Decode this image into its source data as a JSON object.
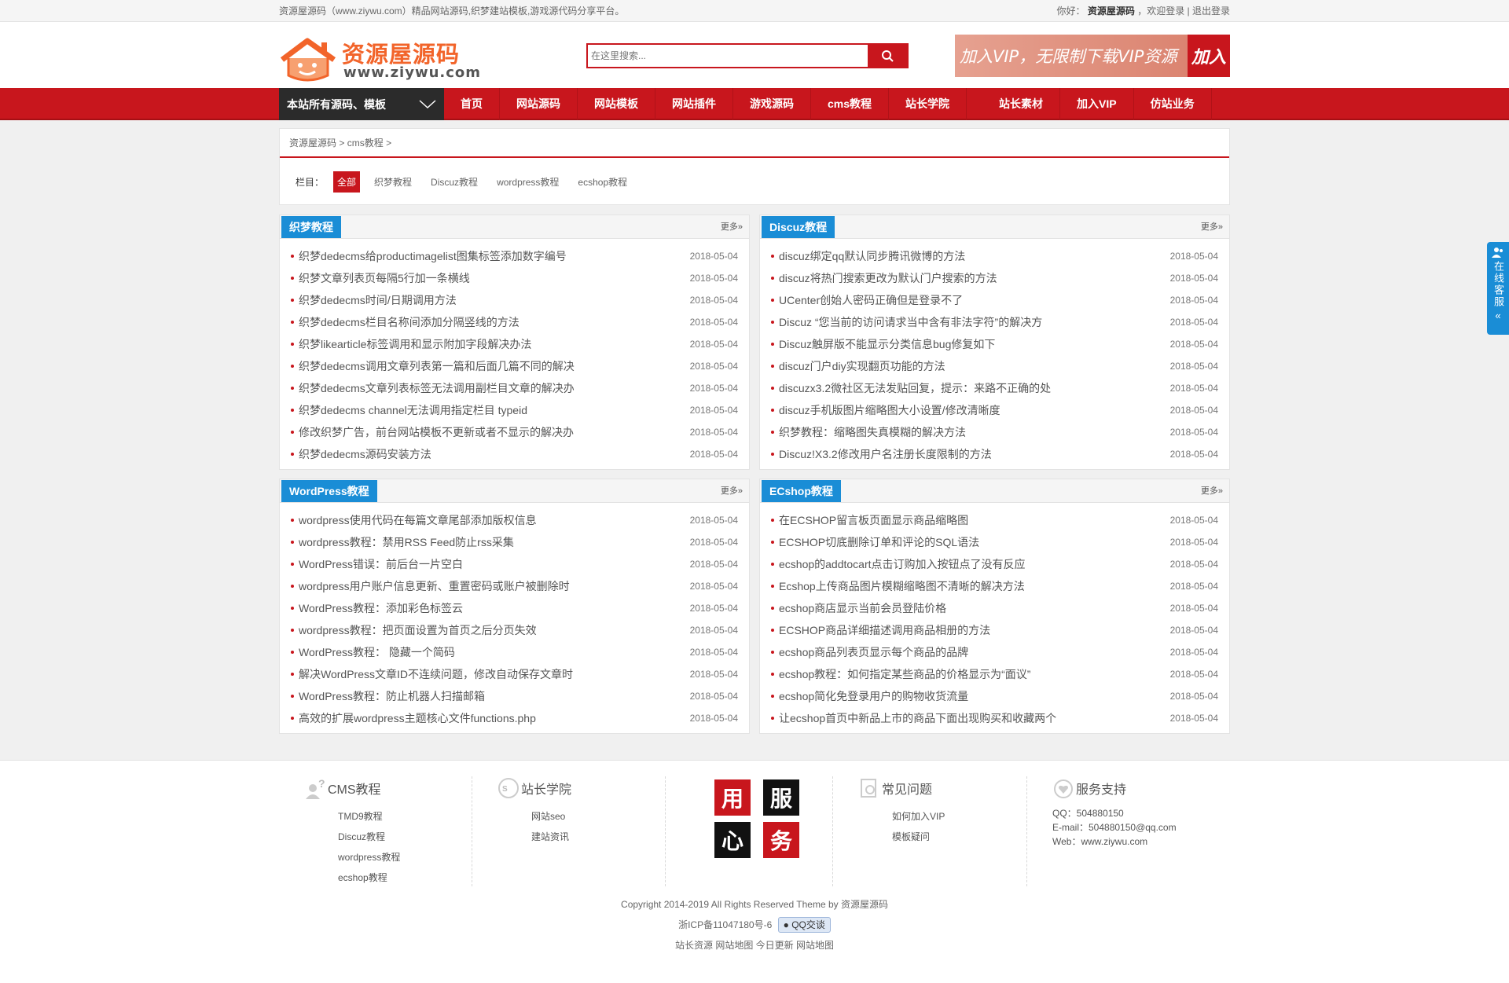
{
  "topbar": {
    "left": "资源屋源码（www.ziywu.com）精品网站源码,织梦建站模板,游戏源代码分享平台。",
    "hello": "你好：",
    "user": "资源屋源码",
    "welcome": "，欢迎登录 |",
    "logout": "退出登录"
  },
  "header": {
    "logo_brand": "资源屋源码",
    "logo_url": "www.ziywu.com",
    "search_placeholder": "在这里搜索...",
    "vip_text": "加入VIP，无限制下载VIP资源",
    "vip_join": "加入"
  },
  "nav": {
    "all": "本站所有源码、模板",
    "items": [
      "首页",
      "网站源码",
      "网站模板",
      "网站插件",
      "游戏源码",
      "cms教程",
      "站长学院",
      "站长素材",
      "加入VIP",
      "仿站业务"
    ]
  },
  "breadcrumb": {
    "home": "资源屋源码",
    "sep1": ">",
    "current": "cms教程",
    "sep2": ">"
  },
  "filters": {
    "label": "栏目：",
    "items": [
      "全部",
      "织梦教程",
      "Discuz教程",
      "wordpress教程",
      "ecshop教程"
    ]
  },
  "panels": [
    {
      "title": "织梦教程",
      "more": "更多»",
      "rows": [
        {
          "t": "织梦dedecms给productimagelist图集标签添加数字编号",
          "d": "2018-05-04"
        },
        {
          "t": "织梦文章列表页每隔5行加一条横线",
          "d": "2018-05-04"
        },
        {
          "t": "织梦dedecms时间/日期调用方法",
          "d": "2018-05-04"
        },
        {
          "t": "织梦dedecms栏目名称间添加分隔竖线的方法",
          "d": "2018-05-04"
        },
        {
          "t": "织梦likearticle标签调用和显示附加字段解决办法",
          "d": "2018-05-04"
        },
        {
          "t": "织梦dedecms调用文章列表第一篇和后面几篇不同的解决",
          "d": "2018-05-04"
        },
        {
          "t": "织梦dedecms文章列表标签无法调用副栏目文章的解决办",
          "d": "2018-05-04"
        },
        {
          "t": "织梦dedecms channel无法调用指定栏目 typeid",
          "d": "2018-05-04"
        },
        {
          "t": "修改织梦广告，前台网站模板不更新或者不显示的解决办",
          "d": "2018-05-04"
        },
        {
          "t": "织梦dedecms源码安装方法",
          "d": "2018-05-04"
        }
      ]
    },
    {
      "title": "Discuz教程",
      "more": "更多»",
      "rows": [
        {
          "t": "discuz绑定qq默认同步腾讯微博的方法",
          "d": "2018-05-04"
        },
        {
          "t": "discuz将热门搜索更改为默认门户搜索的方法",
          "d": "2018-05-04"
        },
        {
          "t": "UCenter创始人密码正确但是登录不了",
          "d": "2018-05-04"
        },
        {
          "t": "Discuz “您当前的访问请求当中含有非法字符”的解决方",
          "d": "2018-05-04"
        },
        {
          "t": "Discuz触屏版不能显示分类信息bug修复如下",
          "d": "2018-05-04"
        },
        {
          "t": "discuz门户diy实现翻页功能的方法",
          "d": "2018-05-04"
        },
        {
          "t": "discuzx3.2微社区无法发贴回复，提示：来路不正确的处",
          "d": "2018-05-04"
        },
        {
          "t": "discuz手机版图片缩略图大小设置/修改清晰度",
          "d": "2018-05-04"
        },
        {
          "t": "织梦教程：缩略图失真模糊的解决方法",
          "d": "2018-05-04"
        },
        {
          "t": "Discuz!X3.2修改用户名注册长度限制的方法",
          "d": "2018-05-04"
        }
      ]
    },
    {
      "title": "WordPress教程",
      "more": "更多»",
      "rows": [
        {
          "t": "wordpress使用代码在每篇文章尾部添加版权信息",
          "d": "2018-05-04"
        },
        {
          "t": "wordpress教程：禁用RSS Feed防止rss采集",
          "d": "2018-05-04"
        },
        {
          "t": "WordPress错误：前后台一片空白",
          "d": "2018-05-04"
        },
        {
          "t": "wordpress用户账户信息更新、重置密码或账户被删除时",
          "d": "2018-05-04"
        },
        {
          "t": "WordPress教程：添加彩色标签云",
          "d": "2018-05-04"
        },
        {
          "t": "wordpress教程：把页面设置为首页之后分页失效",
          "d": "2018-05-04"
        },
        {
          "t": "WordPress教程： 隐藏一个简码",
          "d": "2018-05-04"
        },
        {
          "t": "解决WordPress文章ID不连续问题，修改自动保存文章时",
          "d": "2018-05-04"
        },
        {
          "t": "WordPress教程：防止机器人扫描邮箱",
          "d": "2018-05-04"
        },
        {
          "t": "高效的扩展wordpress主题核心文件functions.php",
          "d": "2018-05-04"
        }
      ]
    },
    {
      "title": "ECshop教程",
      "more": "更多»",
      "rows": [
        {
          "t": "在ECSHOP留言板页面显示商品缩略图",
          "d": "2018-05-04"
        },
        {
          "t": "ECSHOP切底删除订单和评论的SQL语法",
          "d": "2018-05-04"
        },
        {
          "t": "ecshop的addtocart点击订购加入按钮点了没有反应",
          "d": "2018-05-04"
        },
        {
          "t": "Ecshop上传商品图片模糊缩略图不清晰的解决方法",
          "d": "2018-05-04"
        },
        {
          "t": "ecshop商店显示当前会员登陆价格",
          "d": "2018-05-04"
        },
        {
          "t": "ECSHOP商品详细描述调用商品相册的方法",
          "d": "2018-05-04"
        },
        {
          "t": "ecshop商品列表页显示每个商品的品牌",
          "d": "2018-05-04"
        },
        {
          "t": "ecshop教程：如何指定某些商品的价格显示为“面议”",
          "d": "2018-05-04"
        },
        {
          "t": "ecshop简化免登录用户的购物收货流量",
          "d": "2018-05-04"
        },
        {
          "t": "让ecshop首页中新品上市的商品下面出现购买和收藏两个",
          "d": "2018-05-04"
        }
      ]
    }
  ],
  "footer": {
    "cms_title": "CMS教程",
    "cms_links": [
      "TMD9教程",
      "Discuz教程",
      "wordpress教程",
      "ecshop教程"
    ],
    "school_title": "站长学院",
    "school_links": [
      "网站seo",
      "建站资讯"
    ],
    "big_chars": [
      "用",
      "服",
      "心",
      "务"
    ],
    "faq_title": "常见问题",
    "faq_links": [
      "如何加入VIP",
      "模板疑问"
    ],
    "support_title": "服务支持",
    "support_qq": "QQ：504880150",
    "support_email": "E-mail：504880150@qq.com",
    "support_web": "Web：www.ziywu.com",
    "copyright": "Copyright 2014-2019 All Rights Reserved Theme by 资源屋源码",
    "icp": "浙ICP备11047180号-6",
    "qq_btn": "QQ交谈",
    "bottom_links": "站长资源 网站地图 今日更新 网站地图"
  },
  "side": {
    "label": "在线客服"
  },
  "colors": {
    "brand_red": "#c8161d",
    "panel_blue": "#1a8dd6",
    "logo_orange": "#f2642a"
  }
}
